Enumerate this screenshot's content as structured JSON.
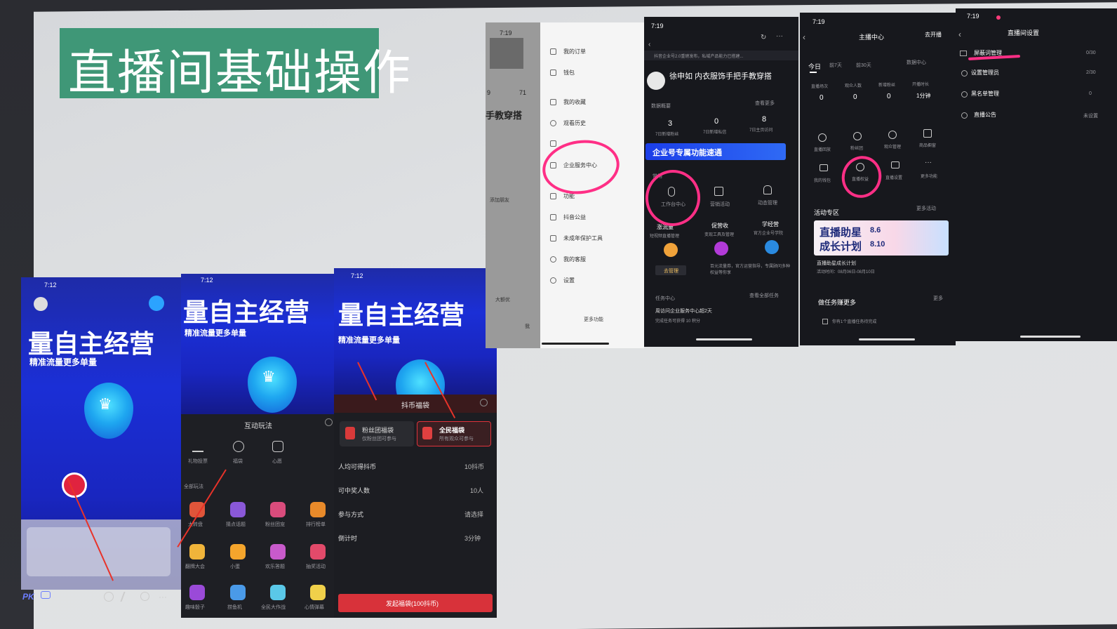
{
  "slide": {
    "title": "直播间基础操作"
  },
  "phones": {
    "a": {
      "time": "7:12",
      "big_title": "量自主经营",
      "subtitle": "精准流量更多单量",
      "pk": "PK"
    },
    "b": {
      "time": "7:12",
      "big_title": "量自主经营",
      "subtitle": "精准流量更多单量",
      "panel_title": "互动玩法",
      "tools": [
        "礼物投票",
        "福袋",
        "心愿"
      ],
      "section": "全部玩法",
      "games": [
        "大转盘",
        "猜点话题",
        "粉丝团宠",
        "排行榜单",
        "翻牌大会",
        "小蛋",
        "欢乐答题",
        "抽奖活动",
        "趣味骰子",
        "捞鱼机",
        "全民大作战",
        "心情弹幕"
      ]
    },
    "c": {
      "time": "7:12",
      "big_title": "量自主经营",
      "subtitle": "精准流量更多单量",
      "panel_title": "抖币福袋",
      "fan_bag": "粉丝团福袋",
      "fan_bag_sub": "仅粉丝团可参与",
      "all_bag": "全民福袋",
      "all_bag_sub": "所有观众可参与",
      "rows": [
        {
          "label": "人均可得抖币",
          "value": "10抖币"
        },
        {
          "label": "可中奖人数",
          "value": "10人"
        },
        {
          "label": "参与方式",
          "value": "请选择"
        },
        {
          "label": "倒计时",
          "value": "3分钟"
        }
      ],
      "launch_button": "发起福袋(100抖币)"
    }
  },
  "menu": {
    "time": "7:19",
    "profile_label": "手教穿搭",
    "stats": [
      "9",
      "71"
    ],
    "side": [
      "添加朋友"
    ],
    "items": [
      "我的订单",
      "钱包",
      "我的收藏",
      "观看历史",
      "",
      "企业服务中心",
      "功能",
      "抖音公益",
      "未成年保护工具",
      "我的客服",
      "设置"
    ],
    "more": "更多功能",
    "popup": "大额优",
    "mine": "我"
  },
  "enterprise": {
    "time": "7:19",
    "notice": "抖音企业号2.0重磅发布，私域产品能力已搭建...",
    "account_name": "徐申如 内衣服饰手把手教穿搭",
    "data_label": "数据概要",
    "more_data": "查看更多",
    "stats": [
      {
        "value": "3",
        "label": "7日新增粉丝"
      },
      {
        "value": "0",
        "label": "7日新增私信"
      },
      {
        "value": "8",
        "label": "7日主页访问"
      }
    ],
    "banner": "企业号专属功能速通",
    "common": "常用",
    "tools": [
      {
        "label": "工作台中心"
      },
      {
        "label": "营销活动"
      },
      {
        "label": "动态管理"
      }
    ],
    "cards": [
      {
        "title": "涨流量",
        "sub": "短视频直播管理"
      },
      {
        "title": "促营收",
        "sub": "变现工具及管理"
      },
      {
        "title": "学经营",
        "sub": "官方企业号学院"
      }
    ],
    "card_button": "去管理",
    "card_note": "百元流量券，官方运营指导，专属顾问多种权益等你享",
    "task_title": "任务中心",
    "task_more": "查看全部任务",
    "task_text": "周访问企业服务中心超2天",
    "task_reward": "完成任务可获得 10 积分"
  },
  "anchor": {
    "time": "7:19",
    "title": "主播中心",
    "start_live": "去开播",
    "tabs": [
      "今日",
      "前7天",
      "前30天"
    ],
    "data_center": "数据中心",
    "stats": [
      {
        "label": "直播场次",
        "value": "0"
      },
      {
        "label": "观众人数",
        "value": "0"
      },
      {
        "label": "新增粉丝",
        "value": "0"
      },
      {
        "label": "开播时长",
        "value": "1分钟"
      }
    ],
    "tools": [
      "直播回放",
      "粉丝团",
      "观众管理",
      "商品橱窗",
      "我的钱包",
      "直播权益",
      "直播设置",
      "更多功能"
    ],
    "activity": "活动专区",
    "more_activity": "更多活动",
    "banner_line1": "直播助星",
    "banner_line2": "成长计划",
    "banner_date1": "8.6",
    "banner_date2": "8.10",
    "banner_caption": "直播助星成长计划",
    "banner_time": "活动时间：08月06日-08月10日",
    "tasks": "做任务赚更多",
    "tasks_more": "更多",
    "task_item": "你有1个直播任务待完成"
  },
  "settings": {
    "time": "7:19",
    "title": "直播间设置",
    "items": [
      "屏蔽词管理",
      "设置管理员",
      "黑名单管理",
      "直播公告"
    ],
    "right_values": [
      "0/30",
      "2/30",
      "0",
      "未设置"
    ]
  },
  "colors": {
    "title_green": "#3f9777",
    "pink_circle": "#ff2f86",
    "red_arrow": "#e8332a",
    "live_blue": "#1b2fd6",
    "launch_red": "#e0333b"
  }
}
